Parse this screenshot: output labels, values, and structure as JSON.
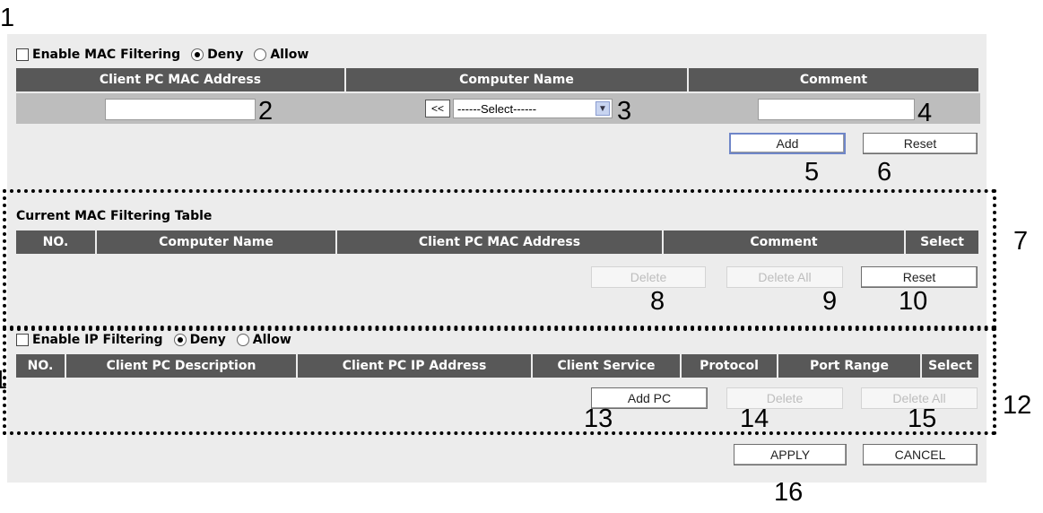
{
  "callouts": [
    "1",
    "2",
    "3",
    "4",
    "5",
    "6",
    "7",
    "8",
    "9",
    "10",
    "1",
    "12",
    "13",
    "14",
    "15",
    "16"
  ],
  "mac_filter": {
    "enable_label": "Enable MAC Filtering",
    "deny_label": "Deny",
    "allow_label": "Allow",
    "mode": "Deny",
    "columns": [
      "Client PC MAC Address",
      "Computer Name",
      "Comment"
    ],
    "mac_value": "",
    "copy_button": "<<",
    "select_value": "------Select------",
    "comment_value": "",
    "add_label": "Add",
    "reset_label": "Reset"
  },
  "mac_table": {
    "title": "Current MAC Filtering Table",
    "columns": [
      "NO.",
      "Computer Name",
      "Client PC MAC Address",
      "Comment",
      "Select"
    ],
    "delete_label": "Delete",
    "delete_all_label": "Delete All",
    "reset_label": "Reset"
  },
  "ip_filter": {
    "enable_label": "Enable IP Filtering",
    "deny_label": "Deny",
    "allow_label": "Allow",
    "mode": "Deny",
    "columns": [
      "NO.",
      "Client PC Description",
      "Client PC IP Address",
      "Client Service",
      "Protocol",
      "Port Range",
      "Select"
    ],
    "add_pc_label": "Add PC",
    "delete_label": "Delete",
    "delete_all_label": "Delete All"
  },
  "footer": {
    "apply_label": "APPLY",
    "cancel_label": "CANCEL"
  }
}
